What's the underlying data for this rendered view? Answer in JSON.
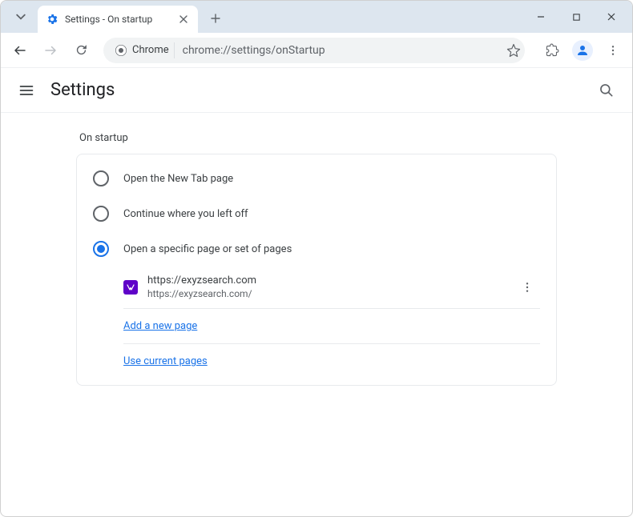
{
  "window": {
    "tab_title": "Settings - On startup"
  },
  "toolbar": {
    "omnibox_chip": "Chrome",
    "omnibox_url": "chrome://settings/onStartup"
  },
  "header": {
    "title": "Settings"
  },
  "section": {
    "label": "On startup"
  },
  "radios": {
    "option1": "Open the New Tab page",
    "option2": "Continue where you left off",
    "option3": "Open a specific page or set of pages"
  },
  "page_entry": {
    "title": "https://exyzsearch.com",
    "url": "https://exyzsearch.com/"
  },
  "links": {
    "add_page": "Add a new page",
    "use_current": "Use current pages"
  }
}
